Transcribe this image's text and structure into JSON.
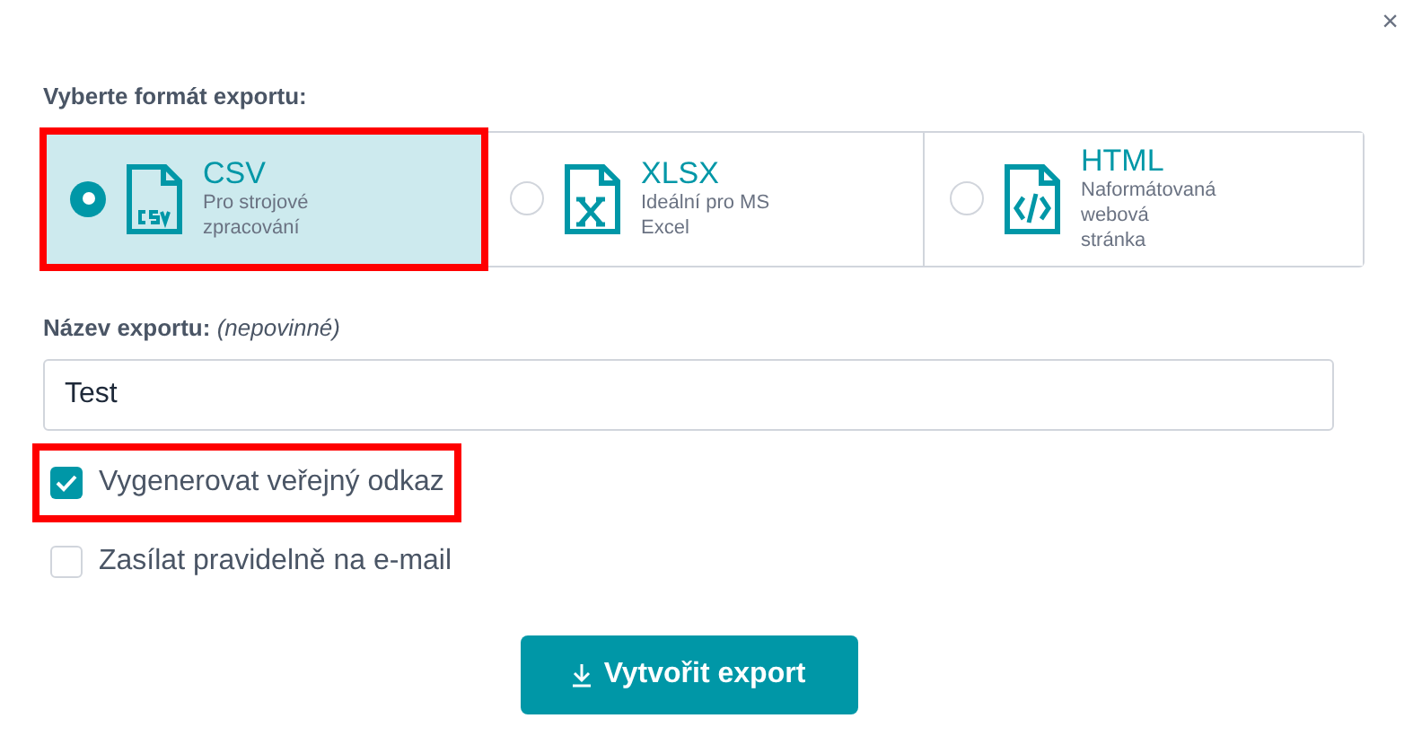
{
  "close_button": "×",
  "format_section": {
    "label": "Vyberte formát exportu:",
    "options": [
      {
        "kind": "csv",
        "title": "CSV",
        "description": "Pro strojové zpracování",
        "selected": true,
        "highlighted": true
      },
      {
        "kind": "xlsx",
        "title": "XLSX",
        "description": "Ideální pro MS Excel",
        "selected": false,
        "highlighted": false
      },
      {
        "kind": "html",
        "title": "HTML",
        "description": "Naformátovaná webová stránka",
        "selected": false,
        "highlighted": false
      }
    ]
  },
  "name_field": {
    "label": "Název exportu:",
    "label_note": "(nepovinné)",
    "value": "Test"
  },
  "checkboxes": [
    {
      "label": "Vygenerovat veřejný odkaz",
      "checked": true,
      "highlighted": true
    },
    {
      "label": "Zasílat pravidelně na e-mail",
      "checked": false,
      "highlighted": false
    }
  ],
  "submit_button": {
    "label": "Vytvořit export"
  }
}
